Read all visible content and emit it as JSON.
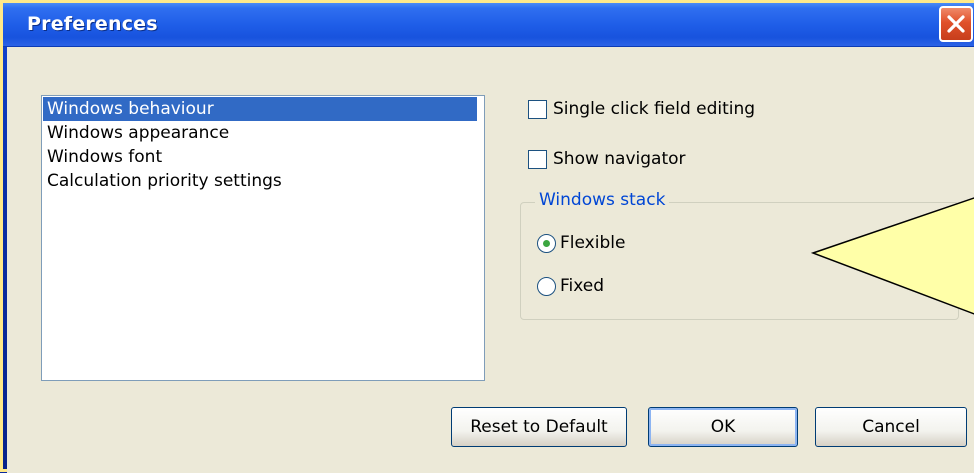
{
  "window": {
    "title": "Preferences"
  },
  "categories": [
    {
      "label": "Windows behaviour",
      "selected": true
    },
    {
      "label": "Windows appearance",
      "selected": false
    },
    {
      "label": "Windows font",
      "selected": false
    },
    {
      "label": "Calculation priority settings",
      "selected": false
    }
  ],
  "options": {
    "single_click": {
      "label": "Single click field editing",
      "checked": false
    },
    "show_navigator": {
      "label": "Show navigator",
      "checked": false
    }
  },
  "windows_stack": {
    "legend": "Windows stack",
    "flexible": {
      "label": "Flexible",
      "checked": true
    },
    "fixed": {
      "label": "Fixed",
      "checked": false
    }
  },
  "buttons": {
    "reset": "Reset to Default",
    "ok": "OK",
    "cancel": "Cancel"
  },
  "colors": {
    "selection": "#316ac5",
    "callout_fill": "#ffffa8",
    "group_legend": "#0046d5"
  }
}
